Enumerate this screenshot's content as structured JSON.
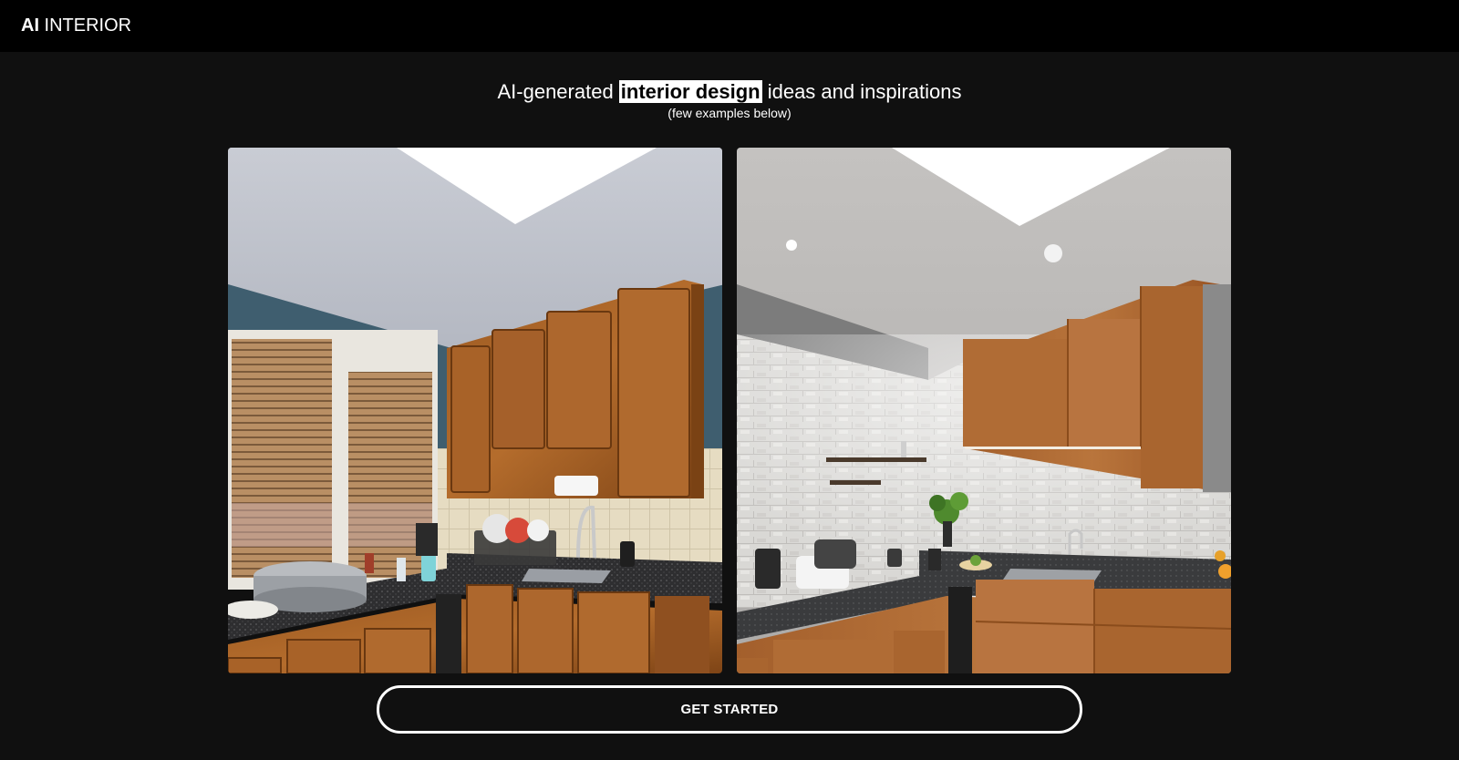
{
  "header": {
    "logo_bold": "AI",
    "logo_rest": " INTERIOR"
  },
  "hero": {
    "title_prefix": "AI-generated ",
    "title_highlight": "interior design",
    "title_suffix": " ideas and inspirations",
    "subtitle": "(few examples below)"
  },
  "examples": [
    {
      "image": "kitchen-before-photo"
    },
    {
      "image": "kitchen-after-photo"
    }
  ],
  "cta": {
    "label": "GET STARTED"
  },
  "colors": {
    "background": "#101010",
    "topbar": "#000000",
    "highlight_bg": "#ffffff",
    "highlight_text": "#000000",
    "text": "#ffffff"
  }
}
